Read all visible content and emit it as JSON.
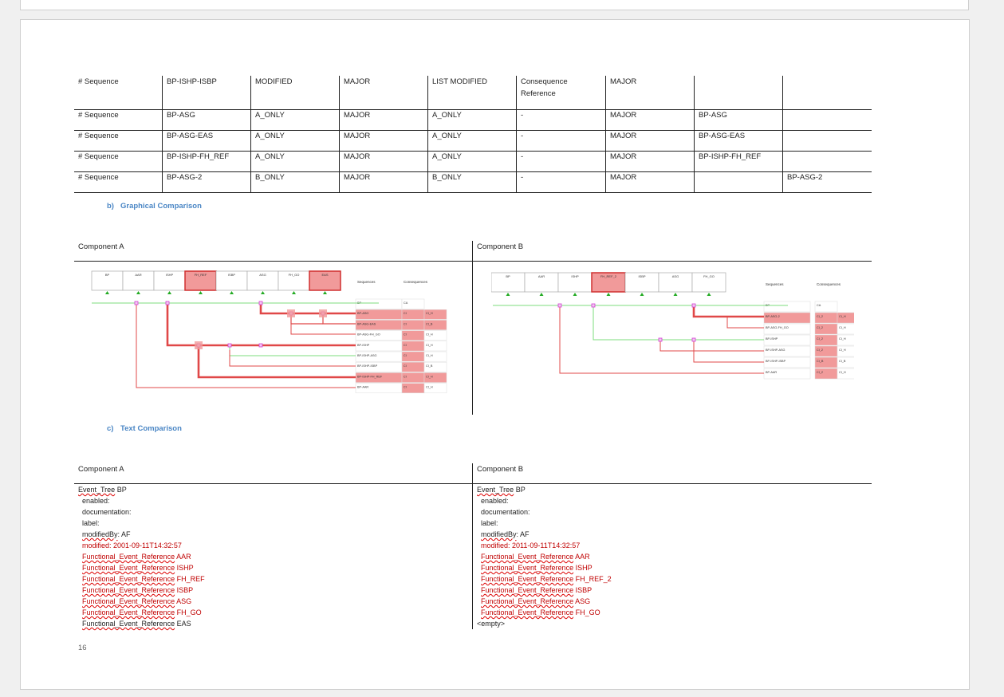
{
  "page_number": "16",
  "sequence_table": {
    "header": [
      "# Sequence",
      "BP-ISHP-ISBP",
      "MODIFIED",
      "MAJOR",
      "LIST MODIFIED",
      "Consequence Reference",
      "MAJOR",
      "",
      ""
    ],
    "rows": [
      [
        "# Sequence",
        "BP-ASG",
        "A_ONLY",
        "MAJOR",
        "A_ONLY",
        "-",
        "MAJOR",
        "BP-ASG",
        ""
      ],
      [
        "# Sequence",
        "BP-ASG-EAS",
        "A_ONLY",
        "MAJOR",
        "A_ONLY",
        "-",
        "MAJOR",
        "BP-ASG-EAS",
        ""
      ],
      [
        "# Sequence",
        "BP-ISHP-FH_REF",
        "A_ONLY",
        "MAJOR",
        "A_ONLY",
        "-",
        "MAJOR",
        "BP-ISHP-FH_REF",
        ""
      ],
      [
        "# Sequence",
        "BP-ASG-2",
        "B_ONLY",
        "MAJOR",
        "B_ONLY",
        "-",
        "MAJOR",
        "",
        "BP-ASG-2"
      ]
    ]
  },
  "graphical_heading": {
    "num": "b)",
    "text": "Graphical Comparison"
  },
  "text_heading": {
    "num": "c)",
    "text": "Text Comparison"
  },
  "graphical": {
    "component_a": "Component A",
    "component_b": "Component B",
    "diagram_a": {
      "events": [
        "BP",
        "AAR",
        "ISHP",
        "FH_REF",
        "ISBP",
        "ASG",
        "FH_GO",
        "EAS"
      ],
      "highlighted_events": [
        "FH_REF",
        "EAS"
      ],
      "sequences_label": "Sequences",
      "consequences_label": "Consequences",
      "sequences": [
        "BP",
        "BP-ASG",
        "BP-ASG-EAS",
        "BP-ASG-FH_GO",
        "BP-ISHP",
        "BP-ISHP-ASG",
        "BP-ISHP-ISBP",
        "BP-ISHP-FH_REF",
        "BP-AAR"
      ],
      "consequences": [
        "CA",
        "CI",
        "CI",
        "CI",
        "CI",
        "CI",
        "CI",
        "CI",
        "CI"
      ],
      "consequences2": [
        "",
        "CI_H",
        "CI_B",
        "CI_H",
        "CI_H",
        "CI_H",
        "CI_B",
        "CI_H",
        "CI_H"
      ]
    },
    "diagram_b": {
      "events": [
        "BP",
        "AAR",
        "ISHP",
        "FH_REF_2",
        "ISBP",
        "ASG",
        "FH_GO"
      ],
      "highlighted_events": [
        "FH_REF_2"
      ],
      "sequences_label": "Sequences",
      "consequences_label": "Consequences",
      "sequences": [
        "BP",
        "BP-ASG-2",
        "BP-ASG-FH_GO",
        "BP-ISHP",
        "BP-ISHP-ASG",
        "BP-ISHP-ISBP",
        "BP-AAR"
      ],
      "consequences": [
        "CA",
        "CI_2",
        "CI_2",
        "CI_2",
        "CI_2",
        "CI_B",
        "CI_2"
      ],
      "consequences2": [
        "",
        "CI_H",
        "CI_H",
        "CI_H",
        "CI_H",
        "CI_B",
        "CI_H"
      ]
    }
  },
  "text_comparison": {
    "component_a": "Component A",
    "component_b": "Component B",
    "a_lines": [
      {
        "pre": "",
        "sq": "Event_Tree",
        "post": " BP",
        "red": false,
        "indent": false
      },
      {
        "pre": "enabled:",
        "sq": "",
        "post": "",
        "red": false,
        "indent": true
      },
      {
        "pre": "documentation:",
        "sq": "",
        "post": "",
        "red": false,
        "indent": true
      },
      {
        "pre": "label:",
        "sq": "",
        "post": "",
        "red": false,
        "indent": true
      },
      {
        "pre": "",
        "sq": "modifiedBy",
        "post": ": AF",
        "red": false,
        "indent": true
      },
      {
        "pre": "modified: 2001-09-11T14:32:57",
        "sq": "",
        "post": "",
        "red": true,
        "indent": true
      },
      {
        "pre": "",
        "sq": "Functional_Event_Reference",
        "post": " AAR",
        "red": true,
        "indent": true
      },
      {
        "pre": "",
        "sq": "Functional_Event_Reference",
        "post": " ISHP",
        "red": true,
        "indent": true
      },
      {
        "pre": "",
        "sq": "Functional_Event_Reference",
        "post": " FH_REF",
        "red": true,
        "indent": true
      },
      {
        "pre": "",
        "sq": "Functional_Event_Reference",
        "post": " ISBP",
        "red": true,
        "indent": true
      },
      {
        "pre": "",
        "sq": "Functional_Event_Reference",
        "post": " ASG",
        "red": true,
        "indent": true
      },
      {
        "pre": "",
        "sq": "Functional_Event_Reference",
        "post": " FH_GO",
        "red": true,
        "indent": true
      },
      {
        "pre": "",
        "sq": "Functional_Event_Reference",
        "post": " EAS",
        "red": false,
        "indent": true
      }
    ],
    "b_lines": [
      {
        "pre": "",
        "sq": "Event_Tree",
        "post": " BP",
        "red": false,
        "indent": false
      },
      {
        "pre": "enabled:",
        "sq": "",
        "post": "",
        "red": false,
        "indent": true
      },
      {
        "pre": "documentation:",
        "sq": "",
        "post": "",
        "red": false,
        "indent": true
      },
      {
        "pre": "label:",
        "sq": "",
        "post": "",
        "red": false,
        "indent": true
      },
      {
        "pre": "",
        "sq": "modifiedBy",
        "post": ": AF",
        "red": false,
        "indent": true
      },
      {
        "pre": "modified: 2011-09-11T14:32:57",
        "sq": "",
        "post": "",
        "red": true,
        "indent": true
      },
      {
        "pre": "",
        "sq": "Functional_Event_Reference",
        "post": " AAR",
        "red": true,
        "indent": true
      },
      {
        "pre": "",
        "sq": "Functional_Event_Reference",
        "post": " ISHP",
        "red": true,
        "indent": true
      },
      {
        "pre": "",
        "sq": "Functional_Event_Reference",
        "post": " FH_REF_2",
        "red": true,
        "indent": true
      },
      {
        "pre": "",
        "sq": "Functional_Event_Reference",
        "post": " ISBP",
        "red": true,
        "indent": true
      },
      {
        "pre": "",
        "sq": "Functional_Event_Reference",
        "post": " ASG",
        "red": true,
        "indent": true
      },
      {
        "pre": "",
        "sq": "Functional_Event_Reference",
        "post": " FH_GO",
        "red": true,
        "indent": true
      },
      {
        "pre": "<empty>",
        "sq": "",
        "post": "",
        "red": false,
        "indent": false
      }
    ]
  },
  "colors": {
    "heading": "#4a86c5",
    "diff_red": "#c00000",
    "highlight": "#f19a9a",
    "path_green": "#7ddc7d",
    "path_red": "#e04848",
    "node_magenta": "#d040d0",
    "triangle_green": "#22aa22"
  }
}
